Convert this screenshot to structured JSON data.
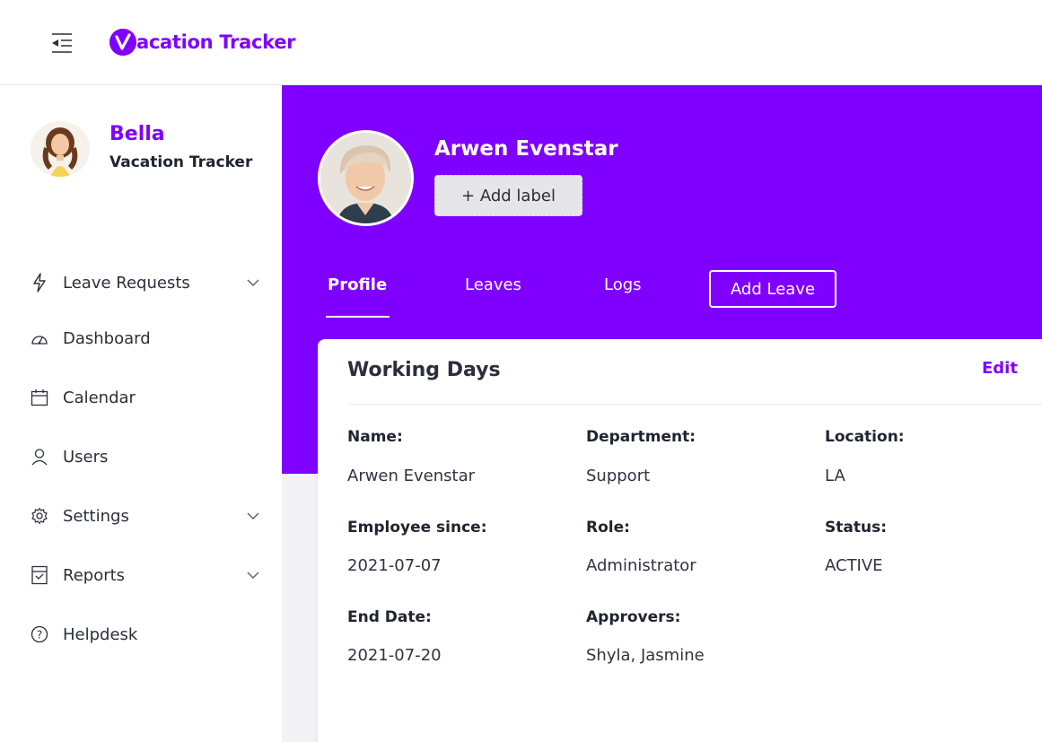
{
  "app": {
    "brand_name": "acation Tracker",
    "brand_logo_letter": "V",
    "brand_color": "#8000ff"
  },
  "sidebar": {
    "user": {
      "name": "Bella",
      "org": "Vacation Tracker"
    },
    "items": [
      {
        "label": "Leave Requests",
        "icon": "lightning-icon",
        "has_chevron": true
      },
      {
        "label": "Dashboard",
        "icon": "gauge-icon",
        "has_chevron": false
      },
      {
        "label": "Calendar",
        "icon": "calendar-icon",
        "has_chevron": false
      },
      {
        "label": "Users",
        "icon": "user-icon",
        "has_chevron": false
      },
      {
        "label": "Settings",
        "icon": "gear-icon",
        "has_chevron": true
      },
      {
        "label": "Reports",
        "icon": "report-icon",
        "has_chevron": true
      },
      {
        "label": "Helpdesk",
        "icon": "help-icon",
        "has_chevron": false
      }
    ]
  },
  "profile": {
    "name": "Arwen Evenstar",
    "add_label": "+ Add label",
    "tabs": [
      {
        "label": "Profile",
        "active": true
      },
      {
        "label": "Leaves",
        "active": false
      },
      {
        "label": "Logs",
        "active": false
      }
    ],
    "add_leave": "Add Leave"
  },
  "card": {
    "title": "Working Days",
    "edit": "Edit",
    "fields": {
      "name": {
        "label": "Name:",
        "value": "Arwen Evenstar"
      },
      "department": {
        "label": "Department:",
        "value": "Support"
      },
      "location": {
        "label": "Location:",
        "value": "LA"
      },
      "employee_since": {
        "label": "Employee since:",
        "value": "2021-07-07"
      },
      "role": {
        "label": "Role:",
        "value": "Administrator"
      },
      "status": {
        "label": "Status:",
        "value": "ACTIVE"
      },
      "end_date": {
        "label": "End Date:",
        "value": "2021-07-20"
      },
      "approvers": {
        "label": "Approvers:",
        "value": "Shyla, Jasmine"
      }
    }
  }
}
